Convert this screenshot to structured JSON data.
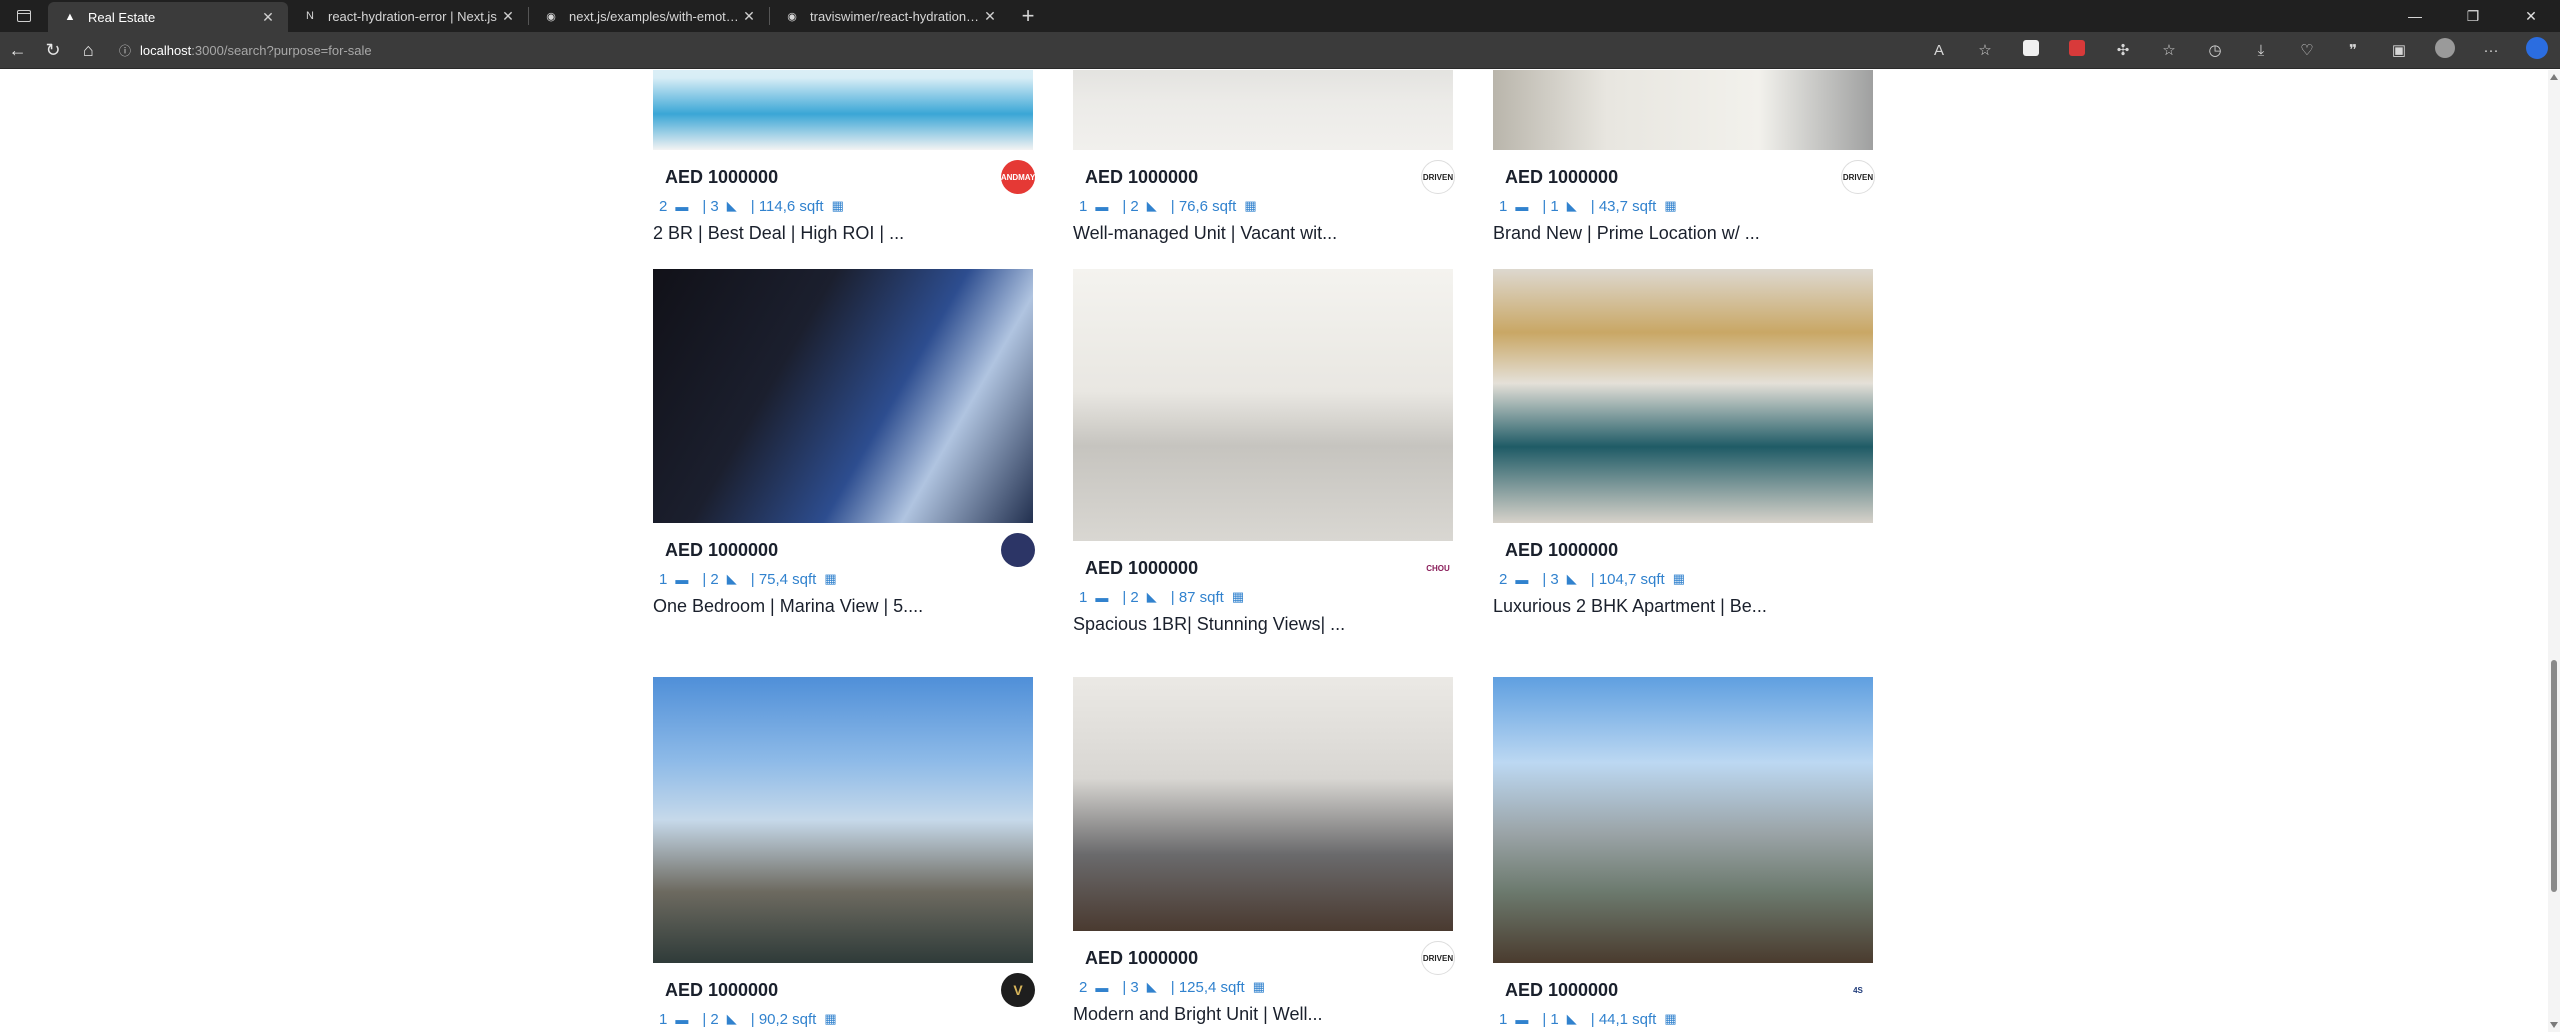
{
  "browser": {
    "tabs": [
      {
        "label": "Real Estate",
        "active": true
      },
      {
        "label": "react-hydration-error | Next.js",
        "active": false
      },
      {
        "label": "next.js/examples/with-emotion a",
        "active": false
      },
      {
        "label": "traviswimer/react-hydration-pro",
        "active": false
      }
    ],
    "url_host": "localhost",
    "url_path": ":3000/search?purpose=for-sale"
  },
  "listings": [
    {
      "price": "AED 1000000",
      "rooms": "2",
      "baths": "| 3",
      "sqft": "| 114,6 sqft",
      "title": "2 BR | Best Deal | High ROI | ...",
      "agency_text": "ANDMAY",
      "agency_color": "#e53935",
      "photo_colors": [
        "#eaf4f9",
        "#3aa6d6"
      ]
    },
    {
      "price": "AED 1000000",
      "rooms": "1",
      "baths": "| 2",
      "sqft": "| 76,6 sqft",
      "title": "Well-managed Unit | Vacant wit...",
      "agency_text": "DRIVEN",
      "agency_color": "#ffffff",
      "photo_colors": [
        "#e2e2e0",
        "#cfcfcc"
      ]
    },
    {
      "price": "AED 1000000",
      "rooms": "1",
      "baths": "| 1",
      "sqft": "| 43,7 sqft",
      "title": "Brand New | Prime Location w/ ...",
      "agency_text": "DRIVEN",
      "agency_color": "#ffffff",
      "photo_colors": [
        "#c9c4b8",
        "#efeee9"
      ]
    },
    {
      "price": "AED 1000000",
      "rooms": "1",
      "baths": "| 2",
      "sqft": "| 75,4 sqft",
      "title": "One Bedroom | Marina View | 5....",
      "agency_text": "",
      "agency_color": "#2c3566",
      "photo_colors": [
        "#1a1a22",
        "#2c4a8f"
      ]
    },
    {
      "price": "AED 1000000",
      "rooms": "1",
      "baths": "| 2",
      "sqft": "| 87 sqft",
      "title": "Spacious 1BR| Stunning Views| ...",
      "agency_text": "CHOU",
      "agency_color": "#ffffff",
      "photo_colors": [
        "#ecebe6",
        "#c9c7c0"
      ]
    },
    {
      "price": "AED 1000000",
      "rooms": "2",
      "baths": "| 3",
      "sqft": "| 104,7 sqft",
      "title": "Luxurious 2 BHK Apartment | Be...",
      "agency_text": "",
      "agency_color": "#ffffff",
      "photo_colors": [
        "#d8d3cb",
        "#1f5b66"
      ]
    },
    {
      "price": "AED 1000000",
      "rooms": "1",
      "baths": "| 2",
      "sqft": "| 90,2 sqft",
      "title": "",
      "agency_text": "V",
      "agency_color": "#1e1e1e",
      "photo_colors": [
        "#6fa4df",
        "#2e3a3a"
      ]
    },
    {
      "price": "AED 1000000",
      "rooms": "2",
      "baths": "| 3",
      "sqft": "| 125,4 sqft",
      "title": "Modern and Bright Unit | Well...",
      "agency_text": "DRIVEN",
      "agency_color": "#ffffff",
      "photo_colors": [
        "#e9e7e3",
        "#5c5c5e"
      ]
    },
    {
      "price": "AED 1000000",
      "rooms": "1",
      "baths": "| 1",
      "sqft": "| 44,1 sqft",
      "title": "",
      "agency_text": "4S",
      "agency_color": "#ffffff",
      "photo_colors": [
        "#7bb3e6",
        "#2e3533"
      ]
    }
  ]
}
